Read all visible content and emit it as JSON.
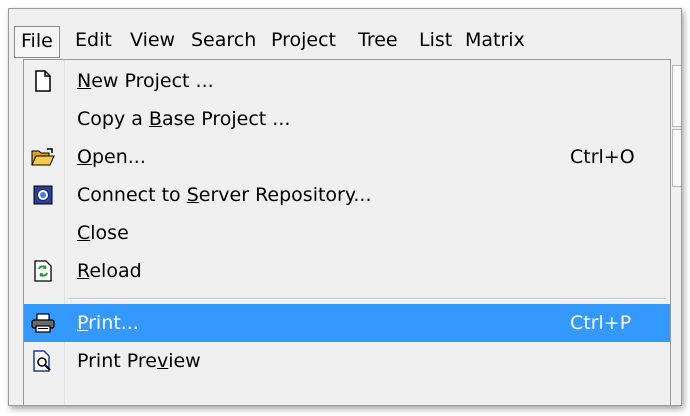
{
  "menubar": {
    "items": [
      {
        "label": "File",
        "active": true
      },
      {
        "label": "Edit"
      },
      {
        "label": "View"
      },
      {
        "label": "Search"
      },
      {
        "label": "Project"
      },
      {
        "label": "Tree"
      },
      {
        "label": "List"
      },
      {
        "label": "Matrix"
      }
    ]
  },
  "file_menu": {
    "items": [
      {
        "pre": "",
        "mnemonic": "N",
        "post": "ew Project ...",
        "shortcut": "",
        "icon": "new-document-icon"
      },
      {
        "pre": "Copy a ",
        "mnemonic": "B",
        "post": "ase Project ...",
        "shortcut": "",
        "icon": ""
      },
      {
        "pre": "",
        "mnemonic": "O",
        "post": "pen...",
        "shortcut": "Ctrl+O",
        "icon": "open-folder-icon"
      },
      {
        "pre": "Connect to ",
        "mnemonic": "S",
        "post": "erver Repository...",
        "shortcut": "",
        "icon": "server-repository-icon"
      },
      {
        "pre": "",
        "mnemonic": "C",
        "post": "lose",
        "shortcut": "",
        "icon": ""
      },
      {
        "pre": "",
        "mnemonic": "R",
        "post": "eload",
        "shortcut": "",
        "icon": "reload-icon"
      },
      {
        "pre": "",
        "mnemonic": "P",
        "post": "rint...",
        "shortcut": "Ctrl+P",
        "icon": "printer-icon",
        "selected": true
      },
      {
        "pre": "Print Pre",
        "mnemonic": "v",
        "post": "iew",
        "shortcut": "",
        "icon": "print-preview-icon"
      }
    ]
  },
  "colors": {
    "highlight": "#3399ff",
    "menu_bg": "#f0f0f0"
  }
}
